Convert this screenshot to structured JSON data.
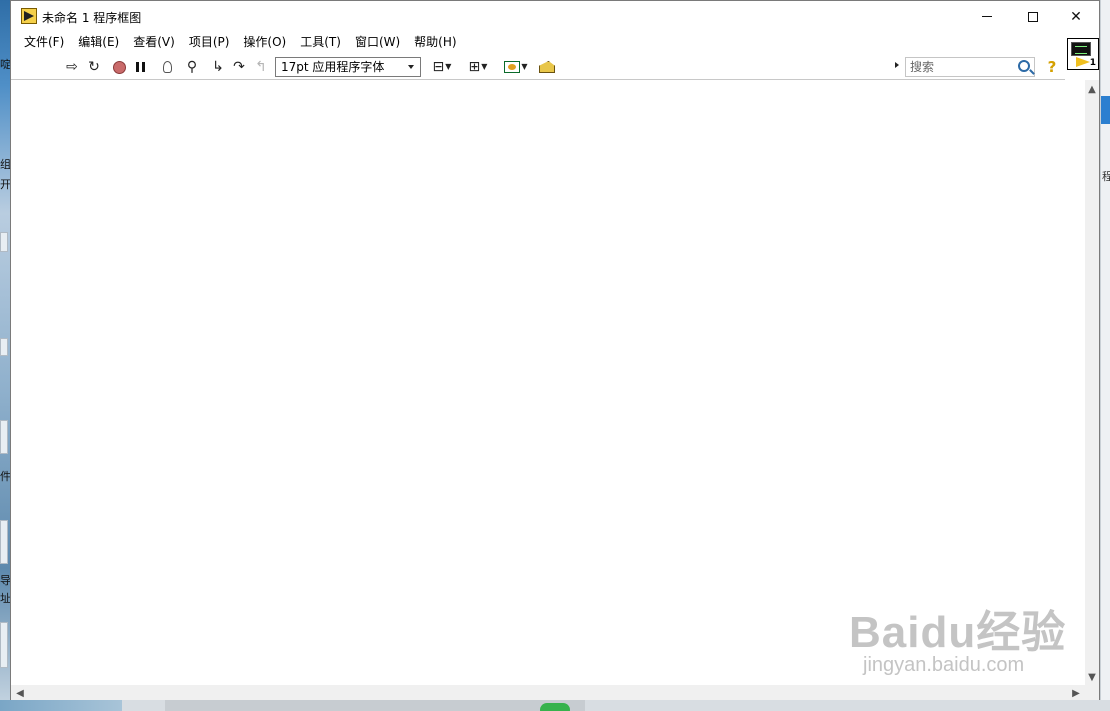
{
  "window": {
    "title": "未命名 1 程序框图",
    "minimize": "—",
    "maximize": "□",
    "close": "✕"
  },
  "menu": [
    {
      "label": "文件(F)"
    },
    {
      "label": "编辑(E)"
    },
    {
      "label": "查看(V)"
    },
    {
      "label": "项目(P)"
    },
    {
      "label": "操作(O)"
    },
    {
      "label": "工具(T)"
    },
    {
      "label": "窗口(W)"
    },
    {
      "label": "帮助(H)"
    }
  ],
  "toolbar": {
    "font": "17pt 应用程序字体",
    "search_placeholder": "搜索",
    "help": "?"
  },
  "vi_icon": {
    "number": "1"
  },
  "icons": {
    "run": "run-arrow-icon",
    "run_continuously": "run-continuously-icon",
    "abort": "abort-stop-icon",
    "pause": "pause-icon",
    "highlight": "highlight-execution-bulb-icon",
    "retain_wire": "retain-wire-values-icon",
    "step_into": "step-into-icon",
    "step_over": "step-over-icon",
    "step_out": "step-out-icon",
    "align": "align-objects-icon",
    "distribute": "distribute-objects-icon",
    "reorder": "reorder-icon",
    "cleanup": "clean-up-diagram-icon"
  },
  "scroll": {
    "up": "▲",
    "down": "▼",
    "left": "◀",
    "right": "▶"
  },
  "background": {
    "left_frags": [
      "啶",
      "组",
      "开",
      "件",
      "导",
      "址"
    ],
    "right_frag": "程"
  },
  "watermark": {
    "brand": "Baidu经验",
    "url": "jingyan.baidu.com"
  }
}
